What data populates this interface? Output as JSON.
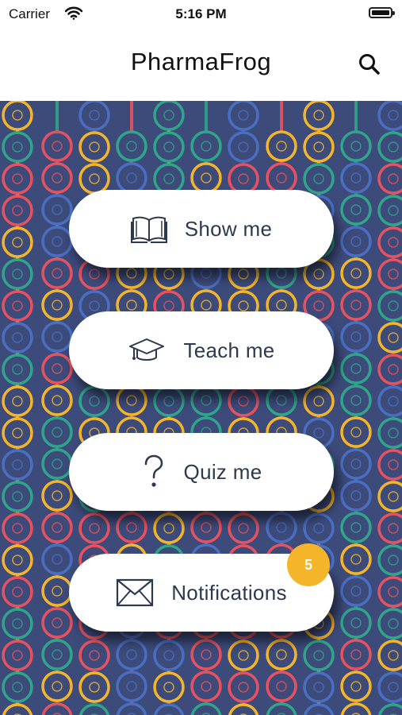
{
  "status_bar": {
    "carrier": "Carrier",
    "time": "5:16 PM"
  },
  "nav": {
    "title": "PharmaFrog",
    "search_icon": "search-icon"
  },
  "menu": {
    "items": [
      {
        "label": "Show me",
        "icon": "open-book-icon"
      },
      {
        "label": "Teach me",
        "icon": "graduation-cap-icon"
      },
      {
        "label": "Quiz me",
        "icon": "question-mark-icon"
      },
      {
        "label": "Notifications",
        "icon": "envelope-icon"
      }
    ],
    "notifications_badge": "5"
  },
  "colors": {
    "background": "#3d4b7b",
    "ring_palette": [
      "#e8525f",
      "#f5b52a",
      "#2fa58a",
      "#4a6fc2"
    ],
    "badge": "#f5b52a",
    "button_text": "#2d3a4d"
  }
}
